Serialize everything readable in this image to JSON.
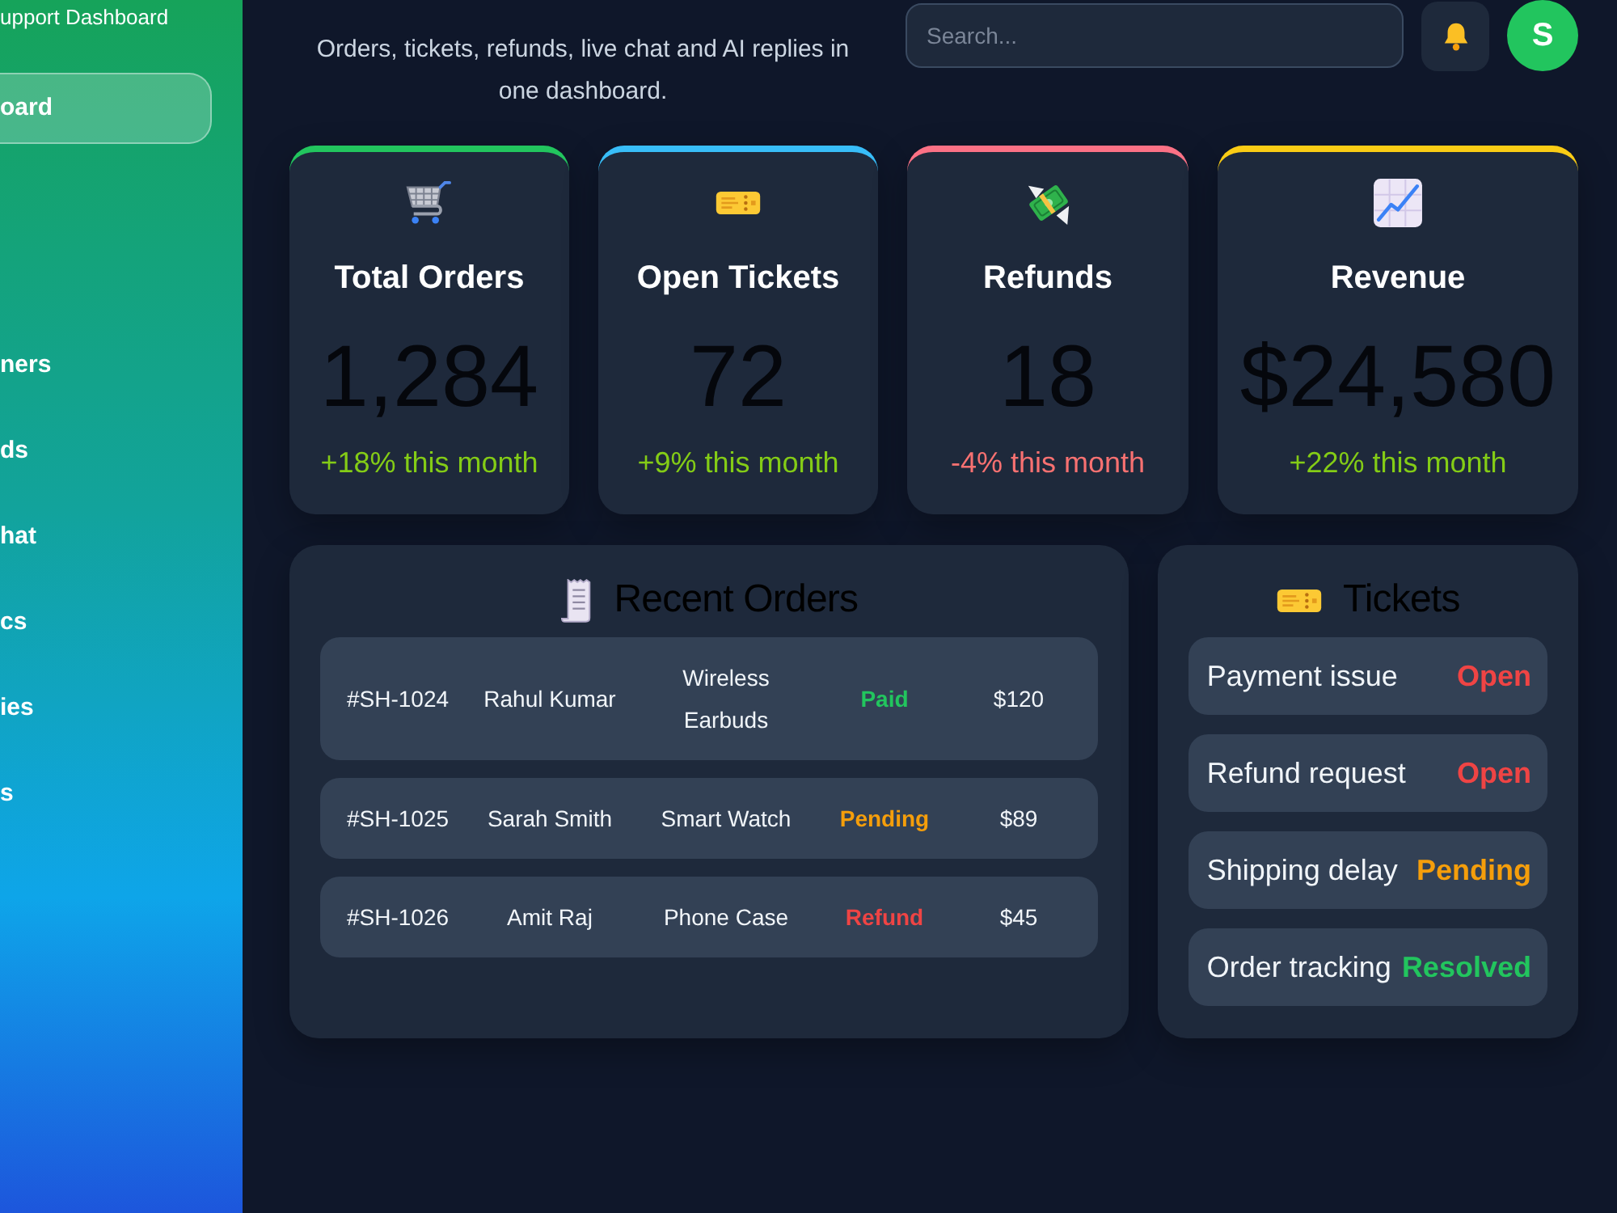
{
  "sidebar": {
    "subtitle": "upport Dashboard",
    "items": [
      {
        "label": "oard",
        "selected": true
      },
      {
        "label": "ners",
        "selected": false
      },
      {
        "label": "ds",
        "selected": false
      },
      {
        "label": "hat",
        "selected": false
      },
      {
        "label": "cs",
        "selected": false
      },
      {
        "label": "ies",
        "selected": false
      },
      {
        "label": "s",
        "selected": false
      }
    ]
  },
  "header": {
    "subtitle": "Orders, tickets, refunds, live chat and AI replies in one dashboard.",
    "search": {
      "placeholder": "Search..."
    },
    "avatar": "S"
  },
  "stats": [
    {
      "kind": "orders",
      "title": "Total Orders",
      "value": "1,284",
      "change": "+18% this month",
      "positive": true,
      "color": "#22c55e"
    },
    {
      "kind": "tickets",
      "title": "Open Tickets",
      "value": "72",
      "change": "+9% this month",
      "positive": true,
      "color": "#38bdf8"
    },
    {
      "kind": "refunds",
      "title": "Refunds",
      "value": "18",
      "change": "-4% this month",
      "positive": false,
      "color": "#fb7185"
    },
    {
      "kind": "revenue",
      "title": "Revenue",
      "value": "$24,580",
      "change": "+22% this month",
      "positive": true,
      "color": "#facc15"
    }
  ],
  "recent_orders": {
    "title": "Recent Orders",
    "rows": [
      {
        "cells": [
          {
            "text": "#SH-1024"
          },
          {
            "text": "Rahul Kumar"
          },
          {
            "text": "Wireless Earbuds"
          },
          {
            "text": "Paid",
            "color": "#22c55e"
          },
          {
            "text": "$120"
          }
        ]
      },
      {
        "cells": [
          {
            "text": "#SH-1025"
          },
          {
            "text": "Sarah Smith"
          },
          {
            "text": "Smart Watch"
          },
          {
            "text": "Pending",
            "color": "#f59e0b"
          },
          {
            "text": "$89"
          }
        ]
      },
      {
        "cells": [
          {
            "text": "#SH-1026"
          },
          {
            "text": "Amit Raj"
          },
          {
            "text": "Phone Case"
          },
          {
            "text": "Refund",
            "color": "#ef4444"
          },
          {
            "text": "$45"
          }
        ]
      }
    ]
  },
  "tickets": {
    "title": "Tickets",
    "items": [
      {
        "title": "Payment issue",
        "status": "Open",
        "color": "#ef4444"
      },
      {
        "title": "Refund request",
        "status": "Open",
        "color": "#ef4444"
      },
      {
        "title": "Shipping delay",
        "status": "Pending",
        "color": "#f59e0b"
      },
      {
        "title": "Order tracking",
        "status": "Resolved",
        "color": "#22c55e"
      }
    ]
  }
}
